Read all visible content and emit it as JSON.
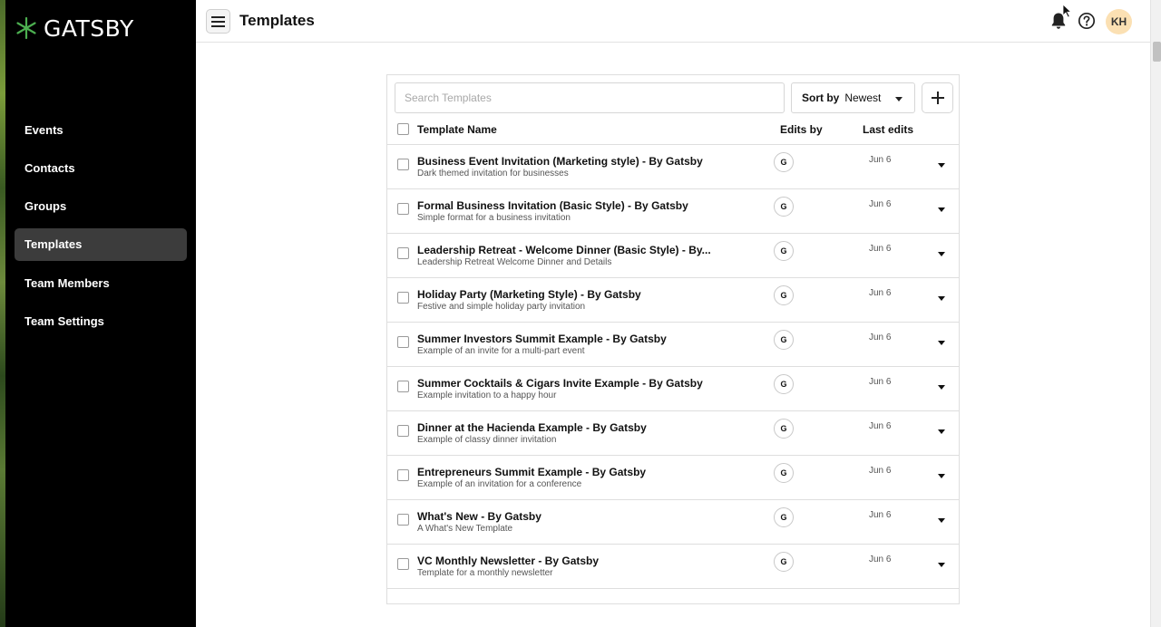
{
  "brand": {
    "name": "GATSBY"
  },
  "sidebar": {
    "items": [
      {
        "label": "Events",
        "active": false
      },
      {
        "label": "Contacts",
        "active": false
      },
      {
        "label": "Groups",
        "active": false
      },
      {
        "label": "Templates",
        "active": true
      },
      {
        "label": "Team Members",
        "active": false
      },
      {
        "label": "Team Settings",
        "active": false
      }
    ]
  },
  "header": {
    "title": "Templates",
    "user_initials": "KH",
    "icons": [
      "menu-icon",
      "bell-icon",
      "help-icon"
    ]
  },
  "toolbar": {
    "search_placeholder": "Search Templates",
    "sort_label": "Sort by",
    "sort_value": "Newest",
    "add_icon": "plus-icon"
  },
  "table": {
    "columns": {
      "name": "Template Name",
      "edits_by": "Edits by",
      "last_edits": "Last edits"
    },
    "rows": [
      {
        "title": "Business Event Invitation (Marketing style) - By Gatsby",
        "subtitle": "Dark themed invitation for businesses",
        "editor": "G",
        "date": "Jun 6"
      },
      {
        "title": "Formal Business Invitation (Basic Style) - By Gatsby",
        "subtitle": "Simple format for a business invitation",
        "editor": "G",
        "date": "Jun 6"
      },
      {
        "title": "Leadership Retreat - Welcome Dinner (Basic Style) - By...",
        "subtitle": "Leadership Retreat Welcome Dinner and Details",
        "editor": "G",
        "date": "Jun 6"
      },
      {
        "title": "Holiday Party (Marketing Style) - By Gatsby",
        "subtitle": "Festive and simple holiday party invitation",
        "editor": "G",
        "date": "Jun 6"
      },
      {
        "title": "Summer Investors Summit Example - By Gatsby",
        "subtitle": "Example of an invite for a multi-part event",
        "editor": "G",
        "date": "Jun 6"
      },
      {
        "title": "Summer Cocktails & Cigars Invite Example - By Gatsby",
        "subtitle": "Example invitation to a happy hour",
        "editor": "G",
        "date": "Jun 6"
      },
      {
        "title": "Dinner at the Hacienda Example - By Gatsby",
        "subtitle": "Example of classy dinner invitation",
        "editor": "G",
        "date": "Jun 6"
      },
      {
        "title": "Entrepreneurs Summit Example - By Gatsby",
        "subtitle": "Example of an invitation for a conference",
        "editor": "G",
        "date": "Jun 6"
      },
      {
        "title": "What's New - By Gatsby",
        "subtitle": "A What's New Template",
        "editor": "G",
        "date": "Jun 6"
      },
      {
        "title": "VC Monthly Newsletter - By Gatsby",
        "subtitle": "Template for a monthly newsletter",
        "editor": "G",
        "date": "Jun 6"
      }
    ]
  },
  "colors": {
    "sidebar_bg": "#000000",
    "active_item_bg": "#3c3c3c",
    "logo_accent": "#4caf50",
    "avatar_bg": "#fbe0b3"
  }
}
